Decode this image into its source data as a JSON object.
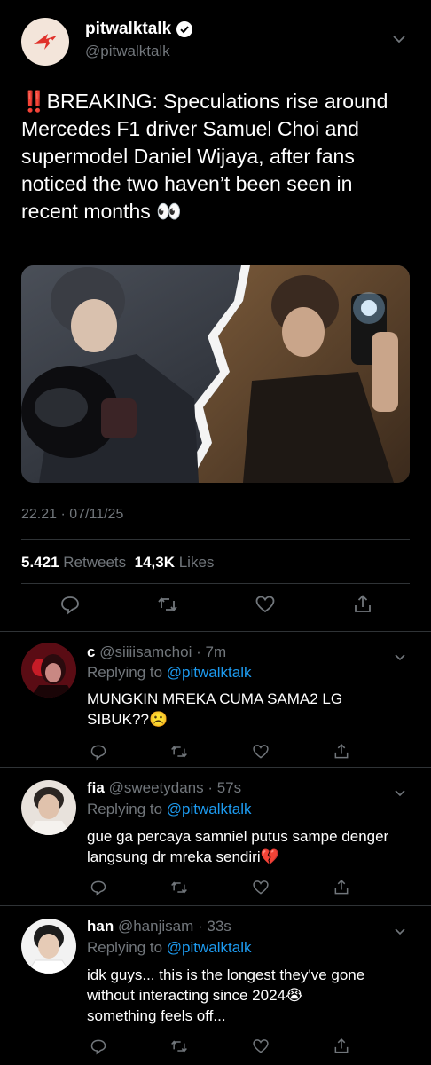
{
  "tweet": {
    "display_name": "pitwalktalk",
    "handle": "@pitwalktalk",
    "text_bang": "‼️",
    "text": "BREAKING: Speculations rise around Mercedes F1 driver Samuel Choi and supermodel Daniel Wijaya, after fans noticed the two haven’t been seen in recent months",
    "text_emoji": "👀",
    "timestamp": "22.21 · 07/11/25",
    "retweets_count": "5.421",
    "retweets_label": "Retweets",
    "likes_count": "14,3K",
    "likes_label": "Likes"
  },
  "replies": [
    {
      "name": "c",
      "handle": "@siiiisamchoi",
      "time": "· 7m",
      "replying_prefix": "Replying to",
      "replying_handle": "@pitwalktalk",
      "text": "MUNGKIN MREKA CUMA SAMA2 LG SIBUK??",
      "emoji": "☹️"
    },
    {
      "name": "fia",
      "handle": "@sweetydans",
      "time": "· 57s",
      "replying_prefix": "Replying to",
      "replying_handle": "@pitwalktalk",
      "text": "gue ga percaya samniel putus sampe denger langsung dr mreka sendiri",
      "emoji": "💔"
    },
    {
      "name": "han",
      "handle": "@hanjisam",
      "time": "· 33s",
      "replying_prefix": "Replying to",
      "replying_handle": "@pitwalktalk",
      "text": "idk guys... this is the longest they've gone without interacting since 2024",
      "text2": "something feels off...",
      "emoji": "😭"
    }
  ],
  "icons": {
    "reply": "comment-icon",
    "retweet": "retweet-icon",
    "like": "heart-icon",
    "share": "share-icon",
    "more": "chevron-down-icon",
    "verified": "verified-badge-icon"
  },
  "colors": {
    "background": "#000000",
    "text": "#e7e9ea",
    "muted": "#71767b",
    "link": "#1d9bf0",
    "brand": "#e0312a"
  }
}
